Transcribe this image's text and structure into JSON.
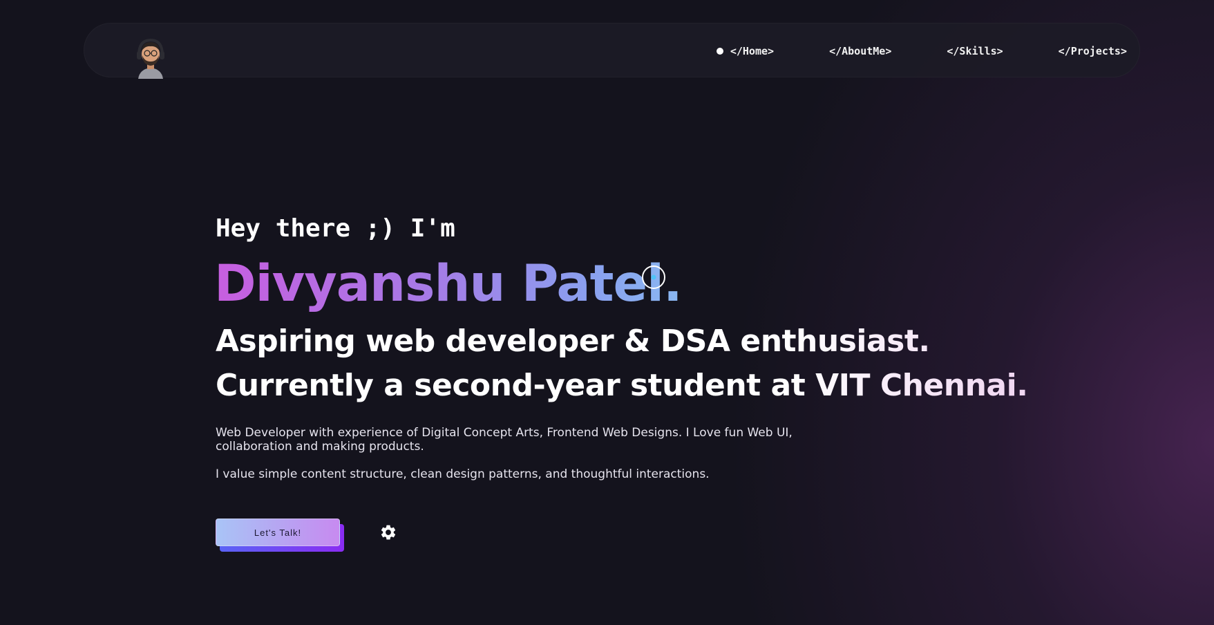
{
  "nav": {
    "items": [
      {
        "label": "</Home>",
        "active": true
      },
      {
        "label": "</AboutMe>",
        "active": false
      },
      {
        "label": "</Skills>",
        "active": false
      },
      {
        "label": "</Projects>",
        "active": false
      }
    ]
  },
  "hero": {
    "greeting": "Hey there ;) I'm",
    "name": "Divyanshu Patel.",
    "tagline_line1": "Aspiring web developer & DSA enthusiast.",
    "tagline_line2": "Currently a second-year student at VIT Chennai.",
    "bio_paragraph_1": "Web Developer with experience of Digital Concept Arts, Frontend Web Designs. I Love fun Web UI, collaboration and making products.",
    "bio_paragraph_2": "I value simple content structure, clean design patterns, and thoughtful interactions.",
    "cta_label": "Let's Talk!"
  },
  "icons": {
    "avatar": "avatar-with-headphones",
    "cursor": "cursor-target-icon",
    "settings": "gear-icon"
  },
  "colors": {
    "background": "#14131d",
    "accent_purple": "#c75ee0",
    "accent_blue": "#8ab8f2",
    "cursor_dot": "#4fc3f7"
  }
}
